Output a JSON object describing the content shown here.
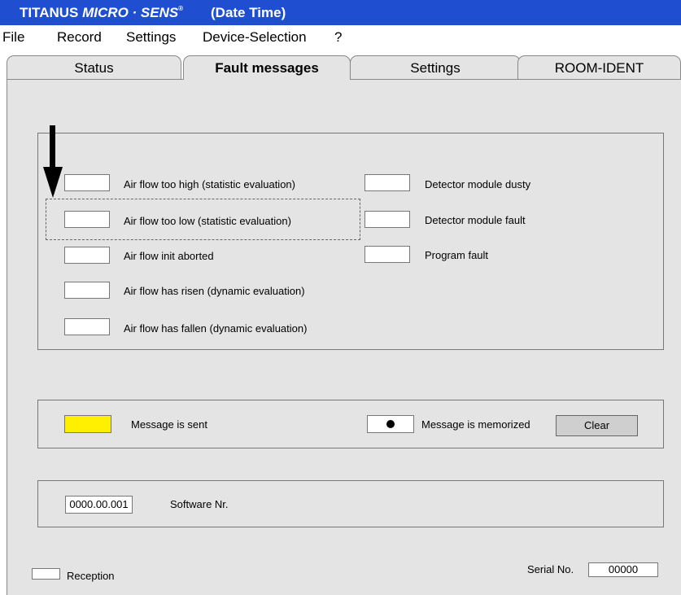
{
  "titlebar": {
    "brand_part1": "TITANUS ",
    "brand_part2": "MICRO · SENS",
    "brand_reg": "®",
    "subtitle": "(Date  Time)"
  },
  "menu": [
    "File",
    "Record",
    "Settings",
    "Device-Selection",
    "?"
  ],
  "tabs": [
    {
      "label": "Status",
      "active": false
    },
    {
      "label": "Fault messages",
      "active": true
    },
    {
      "label": "Settings",
      "active": false
    },
    {
      "label": "ROOM-IDENT",
      "active": false
    }
  ],
  "faults_left": [
    "Air flow too high (statistic evaluation)",
    "Air flow too low (statistic evaluation)",
    "Air flow init aborted",
    "Air flow has risen (dynamic evaluation)",
    "Air flow has fallen (dynamic evaluation)"
  ],
  "faults_right": [
    "Detector module dusty",
    "Detector module fault",
    "Program fault"
  ],
  "legend": {
    "sent_label": "Message is sent",
    "sent_color": "#ffef00",
    "memorized_label": "Message is memorized",
    "clear_button": "Clear"
  },
  "software": {
    "value": "0000.00.001",
    "label": "Software Nr."
  },
  "footer": {
    "reception_label": "Reception",
    "serial_label": "Serial No.",
    "serial_value": "00000"
  }
}
